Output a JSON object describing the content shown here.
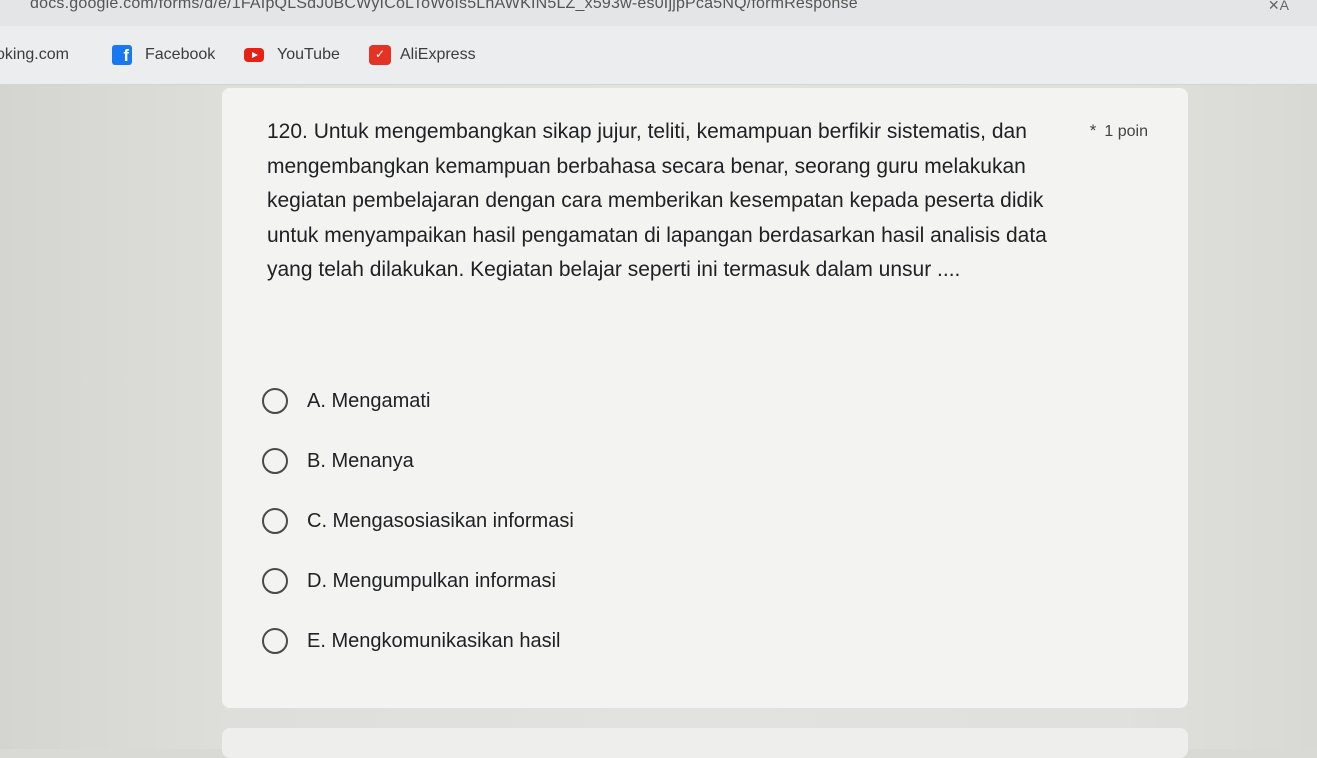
{
  "browser": {
    "url": "docs.google.com/forms/d/e/1FAIpQLSdJ0BCWyICoLToWoIs5LhAWKIN5LZ_x593w-es0IjjpPca5NQ/formResponse",
    "bookmarks": [
      {
        "label": "oking.com",
        "icon": "none"
      },
      {
        "label": "Facebook",
        "icon": "facebook-icon"
      },
      {
        "label": "YouTube",
        "icon": "youtube-icon"
      },
      {
        "label": "AliExpress",
        "icon": "aliexpress-icon"
      }
    ]
  },
  "question": {
    "text": "120. Untuk mengembangkan sikap jujur, teliti, kemampuan berfikir sistematis, dan mengembangkan kemampuan berbahasa secara benar, seorang guru melakukan kegiatan pembelajaran dengan cara memberikan kesempatan kepada peserta didik untuk menyampaikan hasil pengamatan di lapangan berdasarkan hasil analisis data yang telah dilakukan. Kegiatan belajar seperti ini termasuk dalam unsur ....",
    "required_mark": "*",
    "points": "1 poin",
    "options": [
      "A. Mengamati",
      "B. Menanya",
      "C. Mengasosiasikan informasi",
      "D. Mengumpulkan informasi",
      "E. Mengkomunikasikan hasil"
    ]
  },
  "colors": {
    "facebook": "#1877f2",
    "youtube": "#e62117",
    "aliexpress": "#e43225",
    "card": "#f3f3f1"
  }
}
